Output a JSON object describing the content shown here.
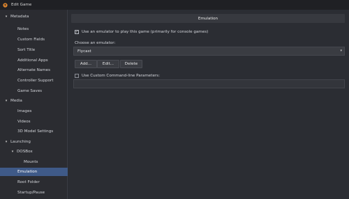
{
  "window": {
    "title": "Edit Game"
  },
  "sidebar": {
    "items": [
      {
        "label": "Metadata",
        "caret": "▾",
        "level": 0
      },
      {
        "label": "Notes",
        "level": 1
      },
      {
        "label": "Custom Fields",
        "level": 1
      },
      {
        "label": "Sort Title",
        "level": 1
      },
      {
        "label": "Additional Apps",
        "level": 1
      },
      {
        "label": "Alternate Names",
        "level": 1
      },
      {
        "label": "Controller Support",
        "level": 1
      },
      {
        "label": "Game Saves",
        "level": 1
      },
      {
        "label": "Media",
        "caret": "▾",
        "level": 0
      },
      {
        "label": "Images",
        "level": 1
      },
      {
        "label": "Videos",
        "level": 1
      },
      {
        "label": "3D Model Settings",
        "level": 1
      },
      {
        "label": "Launching",
        "caret": "▾",
        "level": 0
      },
      {
        "label": "DOSBox",
        "caret": "▾",
        "level": 1
      },
      {
        "label": "Mounts",
        "level": 2
      },
      {
        "label": "Emulation",
        "level": 1,
        "selected": true
      },
      {
        "label": "Root Folder",
        "level": 1
      },
      {
        "label": "Startup/Pause",
        "level": 1
      }
    ]
  },
  "main": {
    "header": "Emulation",
    "use_emulator": {
      "label": "Use an emulator to play this game (primarily for console games)",
      "checked": true,
      "check_glyph": "✓"
    },
    "choose_label": "Choose an emulator:",
    "emulator_select": {
      "value": "Flycast",
      "arrow": "▾"
    },
    "buttons": {
      "add": "Add...",
      "edit": "Edit...",
      "delete": "Delete"
    },
    "custom_params": {
      "label": "Use Custom Command-line Parameters:",
      "checked": false
    }
  },
  "colors": {
    "selected": "#3f5a88",
    "background": "#2b2d33",
    "titlebar": "#1f2024"
  }
}
